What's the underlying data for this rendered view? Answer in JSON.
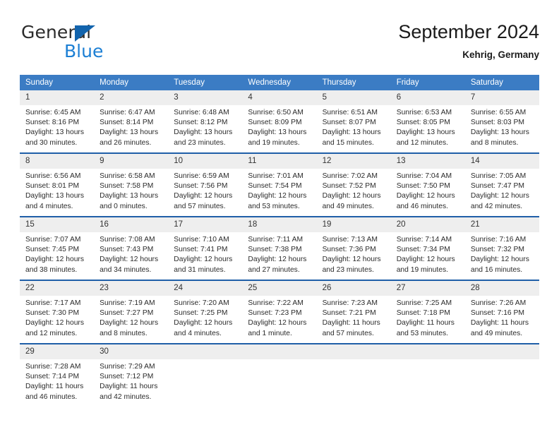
{
  "brand": {
    "name_top": "General",
    "name_bottom": "Blue",
    "triangle_icon": "blue-triangle-logo-mark",
    "color_top": "#2b2b2b",
    "color_bottom": "#1c7fd4",
    "color_triangle": "#1264ad"
  },
  "header": {
    "title": "September 2024",
    "location": "Kehrig, Germany"
  },
  "theme": {
    "header_row_bg": "#3b7cc4",
    "header_row_text": "#ffffff",
    "week_divider": "#1f5fa8",
    "day_number_bg": "#eeeeee",
    "cell_bg": "#ffffff",
    "body_text": "#2b2b2b"
  },
  "weekdays": [
    "Sunday",
    "Monday",
    "Tuesday",
    "Wednesday",
    "Thursday",
    "Friday",
    "Saturday"
  ],
  "weeks": [
    [
      {
        "day": "1",
        "sunrise": "Sunrise: 6:45 AM",
        "sunset": "Sunset: 8:16 PM",
        "daylight_l1": "Daylight: 13 hours",
        "daylight_l2": "and 30 minutes."
      },
      {
        "day": "2",
        "sunrise": "Sunrise: 6:47 AM",
        "sunset": "Sunset: 8:14 PM",
        "daylight_l1": "Daylight: 13 hours",
        "daylight_l2": "and 26 minutes."
      },
      {
        "day": "3",
        "sunrise": "Sunrise: 6:48 AM",
        "sunset": "Sunset: 8:12 PM",
        "daylight_l1": "Daylight: 13 hours",
        "daylight_l2": "and 23 minutes."
      },
      {
        "day": "4",
        "sunrise": "Sunrise: 6:50 AM",
        "sunset": "Sunset: 8:09 PM",
        "daylight_l1": "Daylight: 13 hours",
        "daylight_l2": "and 19 minutes."
      },
      {
        "day": "5",
        "sunrise": "Sunrise: 6:51 AM",
        "sunset": "Sunset: 8:07 PM",
        "daylight_l1": "Daylight: 13 hours",
        "daylight_l2": "and 15 minutes."
      },
      {
        "day": "6",
        "sunrise": "Sunrise: 6:53 AM",
        "sunset": "Sunset: 8:05 PM",
        "daylight_l1": "Daylight: 13 hours",
        "daylight_l2": "and 12 minutes."
      },
      {
        "day": "7",
        "sunrise": "Sunrise: 6:55 AM",
        "sunset": "Sunset: 8:03 PM",
        "daylight_l1": "Daylight: 13 hours",
        "daylight_l2": "and 8 minutes."
      }
    ],
    [
      {
        "day": "8",
        "sunrise": "Sunrise: 6:56 AM",
        "sunset": "Sunset: 8:01 PM",
        "daylight_l1": "Daylight: 13 hours",
        "daylight_l2": "and 4 minutes."
      },
      {
        "day": "9",
        "sunrise": "Sunrise: 6:58 AM",
        "sunset": "Sunset: 7:58 PM",
        "daylight_l1": "Daylight: 13 hours",
        "daylight_l2": "and 0 minutes."
      },
      {
        "day": "10",
        "sunrise": "Sunrise: 6:59 AM",
        "sunset": "Sunset: 7:56 PM",
        "daylight_l1": "Daylight: 12 hours",
        "daylight_l2": "and 57 minutes."
      },
      {
        "day": "11",
        "sunrise": "Sunrise: 7:01 AM",
        "sunset": "Sunset: 7:54 PM",
        "daylight_l1": "Daylight: 12 hours",
        "daylight_l2": "and 53 minutes."
      },
      {
        "day": "12",
        "sunrise": "Sunrise: 7:02 AM",
        "sunset": "Sunset: 7:52 PM",
        "daylight_l1": "Daylight: 12 hours",
        "daylight_l2": "and 49 minutes."
      },
      {
        "day": "13",
        "sunrise": "Sunrise: 7:04 AM",
        "sunset": "Sunset: 7:50 PM",
        "daylight_l1": "Daylight: 12 hours",
        "daylight_l2": "and 46 minutes."
      },
      {
        "day": "14",
        "sunrise": "Sunrise: 7:05 AM",
        "sunset": "Sunset: 7:47 PM",
        "daylight_l1": "Daylight: 12 hours",
        "daylight_l2": "and 42 minutes."
      }
    ],
    [
      {
        "day": "15",
        "sunrise": "Sunrise: 7:07 AM",
        "sunset": "Sunset: 7:45 PM",
        "daylight_l1": "Daylight: 12 hours",
        "daylight_l2": "and 38 minutes."
      },
      {
        "day": "16",
        "sunrise": "Sunrise: 7:08 AM",
        "sunset": "Sunset: 7:43 PM",
        "daylight_l1": "Daylight: 12 hours",
        "daylight_l2": "and 34 minutes."
      },
      {
        "day": "17",
        "sunrise": "Sunrise: 7:10 AM",
        "sunset": "Sunset: 7:41 PM",
        "daylight_l1": "Daylight: 12 hours",
        "daylight_l2": "and 31 minutes."
      },
      {
        "day": "18",
        "sunrise": "Sunrise: 7:11 AM",
        "sunset": "Sunset: 7:38 PM",
        "daylight_l1": "Daylight: 12 hours",
        "daylight_l2": "and 27 minutes."
      },
      {
        "day": "19",
        "sunrise": "Sunrise: 7:13 AM",
        "sunset": "Sunset: 7:36 PM",
        "daylight_l1": "Daylight: 12 hours",
        "daylight_l2": "and 23 minutes."
      },
      {
        "day": "20",
        "sunrise": "Sunrise: 7:14 AM",
        "sunset": "Sunset: 7:34 PM",
        "daylight_l1": "Daylight: 12 hours",
        "daylight_l2": "and 19 minutes."
      },
      {
        "day": "21",
        "sunrise": "Sunrise: 7:16 AM",
        "sunset": "Sunset: 7:32 PM",
        "daylight_l1": "Daylight: 12 hours",
        "daylight_l2": "and 16 minutes."
      }
    ],
    [
      {
        "day": "22",
        "sunrise": "Sunrise: 7:17 AM",
        "sunset": "Sunset: 7:30 PM",
        "daylight_l1": "Daylight: 12 hours",
        "daylight_l2": "and 12 minutes."
      },
      {
        "day": "23",
        "sunrise": "Sunrise: 7:19 AM",
        "sunset": "Sunset: 7:27 PM",
        "daylight_l1": "Daylight: 12 hours",
        "daylight_l2": "and 8 minutes."
      },
      {
        "day": "24",
        "sunrise": "Sunrise: 7:20 AM",
        "sunset": "Sunset: 7:25 PM",
        "daylight_l1": "Daylight: 12 hours",
        "daylight_l2": "and 4 minutes."
      },
      {
        "day": "25",
        "sunrise": "Sunrise: 7:22 AM",
        "sunset": "Sunset: 7:23 PM",
        "daylight_l1": "Daylight: 12 hours",
        "daylight_l2": "and 1 minute."
      },
      {
        "day": "26",
        "sunrise": "Sunrise: 7:23 AM",
        "sunset": "Sunset: 7:21 PM",
        "daylight_l1": "Daylight: 11 hours",
        "daylight_l2": "and 57 minutes."
      },
      {
        "day": "27",
        "sunrise": "Sunrise: 7:25 AM",
        "sunset": "Sunset: 7:18 PM",
        "daylight_l1": "Daylight: 11 hours",
        "daylight_l2": "and 53 minutes."
      },
      {
        "day": "28",
        "sunrise": "Sunrise: 7:26 AM",
        "sunset": "Sunset: 7:16 PM",
        "daylight_l1": "Daylight: 11 hours",
        "daylight_l2": "and 49 minutes."
      }
    ],
    [
      {
        "day": "29",
        "sunrise": "Sunrise: 7:28 AM",
        "sunset": "Sunset: 7:14 PM",
        "daylight_l1": "Daylight: 11 hours",
        "daylight_l2": "and 46 minutes."
      },
      {
        "day": "30",
        "sunrise": "Sunrise: 7:29 AM",
        "sunset": "Sunset: 7:12 PM",
        "daylight_l1": "Daylight: 11 hours",
        "daylight_l2": "and 42 minutes."
      },
      {
        "day": "",
        "sunrise": "",
        "sunset": "",
        "daylight_l1": "",
        "daylight_l2": ""
      },
      {
        "day": "",
        "sunrise": "",
        "sunset": "",
        "daylight_l1": "",
        "daylight_l2": ""
      },
      {
        "day": "",
        "sunrise": "",
        "sunset": "",
        "daylight_l1": "",
        "daylight_l2": ""
      },
      {
        "day": "",
        "sunrise": "",
        "sunset": "",
        "daylight_l1": "",
        "daylight_l2": ""
      },
      {
        "day": "",
        "sunrise": "",
        "sunset": "",
        "daylight_l1": "",
        "daylight_l2": ""
      }
    ]
  ]
}
